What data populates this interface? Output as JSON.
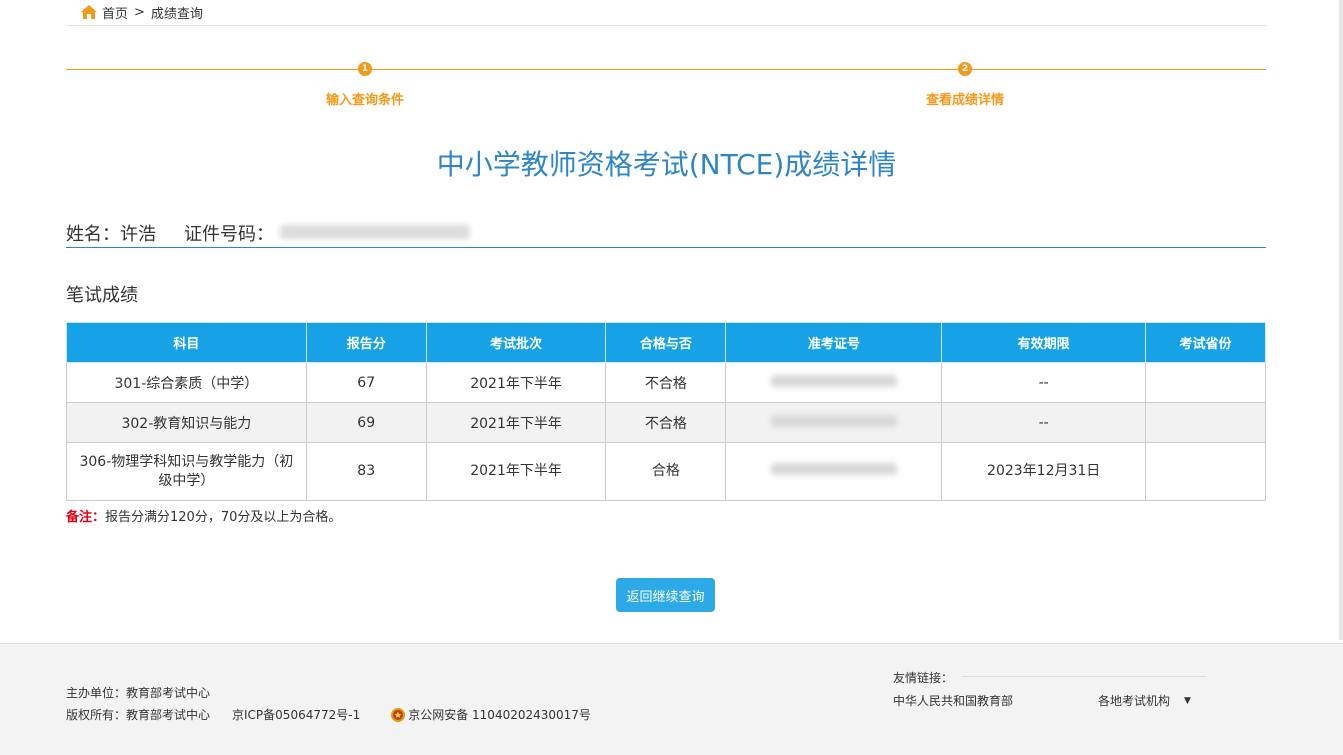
{
  "breadcrumb": {
    "home": "首页",
    "separator": ">",
    "current": "成绩查询"
  },
  "steps": [
    {
      "number": "1",
      "label": "输入查询条件"
    },
    {
      "number": "2",
      "label": "查看成绩详情"
    }
  ],
  "title": "中小学教师资格考试(NTCE)成绩详情",
  "person": {
    "name_label": "姓名：许浩",
    "id_label": "证件号码："
  },
  "section_title": "笔试成绩",
  "table": {
    "headers": [
      "科目",
      "报告分",
      "考试批次",
      "合格与否",
      "准考证号",
      "有效期限",
      "考试省份"
    ],
    "rows": [
      {
        "subject": "301-综合素质（中学）",
        "score": "67",
        "batch": "2021年下半年",
        "result": "不合格",
        "validity": "--",
        "province": ""
      },
      {
        "subject": "302-教育知识与能力",
        "score": "69",
        "batch": "2021年下半年",
        "result": "不合格",
        "validity": "--",
        "province": ""
      },
      {
        "subject": "306-物理学科知识与教学能力（初级中学）",
        "score": "83",
        "batch": "2021年下半年",
        "result": "合格",
        "validity": "2023年12月31日",
        "province": ""
      }
    ]
  },
  "note": {
    "label": "备注：",
    "text": "报告分满分120分，70分及以上为合格。"
  },
  "back_button": "返回继续查询",
  "footer": {
    "organizer": "主办单位：教育部考试中心",
    "copyright": "版权所有：教育部考试中心",
    "icp": "京ICP备05064772号-1",
    "police": "京公网安备 11040202430017号",
    "friend_title": "友情链接：",
    "friend_link": "中华人民共和国教育部",
    "friend_select": "各地考试机构",
    "select_arrow": "▼"
  },
  "colors": {
    "accent_orange": "#f39a1c",
    "title_blue": "#2f86c6",
    "header_blue": "#17a2e6",
    "button_blue": "#2ea9e8",
    "note_red": "#e60012"
  }
}
